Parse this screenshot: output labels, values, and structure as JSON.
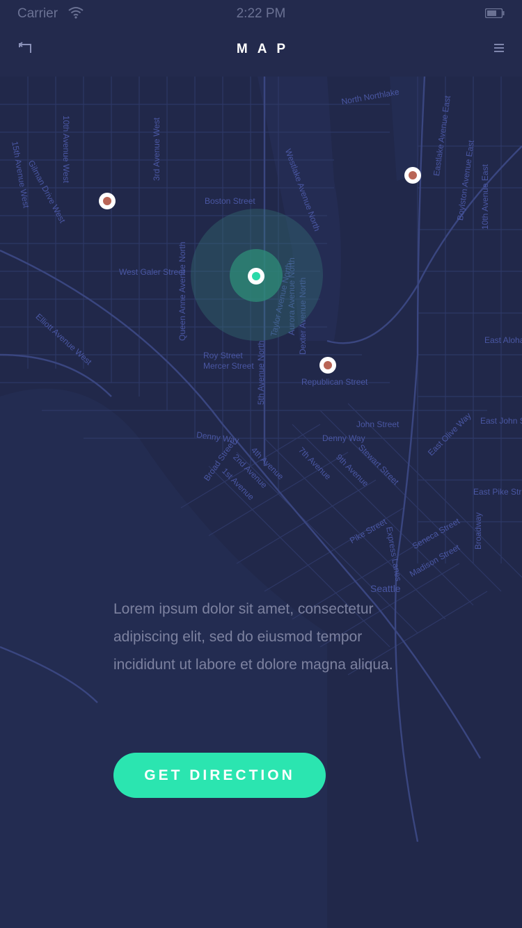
{
  "status_bar": {
    "carrier": "Carrier",
    "time": "2:22 PM",
    "wifi_icon": "wifi-icon",
    "battery_icon": "battery-icon"
  },
  "nav": {
    "title": "MAP",
    "back_icon": "back-arrow-icon",
    "menu_icon": "hamburger-menu-icon"
  },
  "map": {
    "street_labels": [
      "North Northlake",
      "Boston Street",
      "West Galer Street",
      "Roy Street",
      "Mercer Street",
      "Republican Street",
      "John Street",
      "Denny Way",
      "Denny Way",
      "Elliott Avenue West",
      "Queen Anne Avenue North",
      "Westlake Avenue North",
      "Dexter Avenue North",
      "Aurora Avenue North",
      "Taylor Avenue North",
      "5th Avenue North",
      "10th Avenue West",
      "3rd Avenue West",
      "Gilman Drive West",
      "15th Avenue West",
      "Eastlake Avenue East",
      "Boylston Avenue East",
      "10th Avenue East",
      "Broadway",
      "East John St",
      "East Pike Str",
      "East Olive Way",
      "Pike Street",
      "Seneca Street",
      "Madison Street",
      "Seattle",
      "Broad Street",
      "1st Avenue",
      "2nd Avenue",
      "4th Avenue",
      "7th Avenue",
      "9th Avenue",
      "Stewart Street",
      "Express Lanes",
      "East Aloha"
    ],
    "colors": {
      "background": "#21284a",
      "street_label": "#4a57a3",
      "marker_fill": "#b96556",
      "user_dot": "#2bd9a9"
    }
  },
  "content": {
    "description": "Lorem ipsum dolor sit amet, consectetur adipiscing elit, sed do eiusmod tempor incididunt ut labore et dolore magna aliqua.",
    "button_label": "GET DIRECTION",
    "button_color": "#2be5b0"
  }
}
